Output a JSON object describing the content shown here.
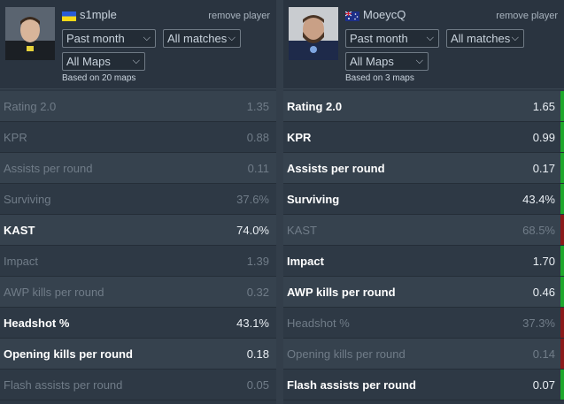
{
  "left": {
    "name": "s1mple",
    "flag": "ukraine-flag",
    "remove": "remove player",
    "period": "Past month",
    "matches": "All matches",
    "maps": "All Maps",
    "based": "Based on 20 maps",
    "rows": [
      {
        "label": "Rating 2.0",
        "value": "1.35",
        "state": "lose"
      },
      {
        "label": "KPR",
        "value": "0.88",
        "state": "lose"
      },
      {
        "label": "Assists per round",
        "value": "0.11",
        "state": "lose"
      },
      {
        "label": "Surviving",
        "value": "37.6%",
        "state": "lose"
      },
      {
        "label": "KAST",
        "value": "74.0%",
        "state": "win"
      },
      {
        "label": "Impact",
        "value": "1.39",
        "state": "lose"
      },
      {
        "label": "AWP kills per round",
        "value": "0.32",
        "state": "lose"
      },
      {
        "label": "Headshot %",
        "value": "43.1%",
        "state": "win"
      },
      {
        "label": "Opening kills per round",
        "value": "0.18",
        "state": "win"
      },
      {
        "label": "Flash assists per round",
        "value": "0.05",
        "state": "lose"
      }
    ]
  },
  "right": {
    "name": "MoeycQ",
    "flag": "australia-flag",
    "remove": "remove player",
    "period": "Past month",
    "matches": "All matches",
    "maps": "All Maps",
    "based": "Based on 3 maps",
    "rows": [
      {
        "label": "Rating 2.0",
        "value": "1.65",
        "state": "win"
      },
      {
        "label": "KPR",
        "value": "0.99",
        "state": "win"
      },
      {
        "label": "Assists per round",
        "value": "0.17",
        "state": "win"
      },
      {
        "label": "Surviving",
        "value": "43.4%",
        "state": "win"
      },
      {
        "label": "KAST",
        "value": "68.5%",
        "state": "lose"
      },
      {
        "label": "Impact",
        "value": "1.70",
        "state": "win"
      },
      {
        "label": "AWP kills per round",
        "value": "0.46",
        "state": "win"
      },
      {
        "label": "Headshot %",
        "value": "37.3%",
        "state": "lose"
      },
      {
        "label": "Opening kills per round",
        "value": "0.14",
        "state": "lose"
      },
      {
        "label": "Flash assists per round",
        "value": "0.07",
        "state": "win"
      }
    ]
  },
  "colors": {
    "win_bar": "#1fa82c",
    "lose_bar": "#8b1a1a"
  }
}
